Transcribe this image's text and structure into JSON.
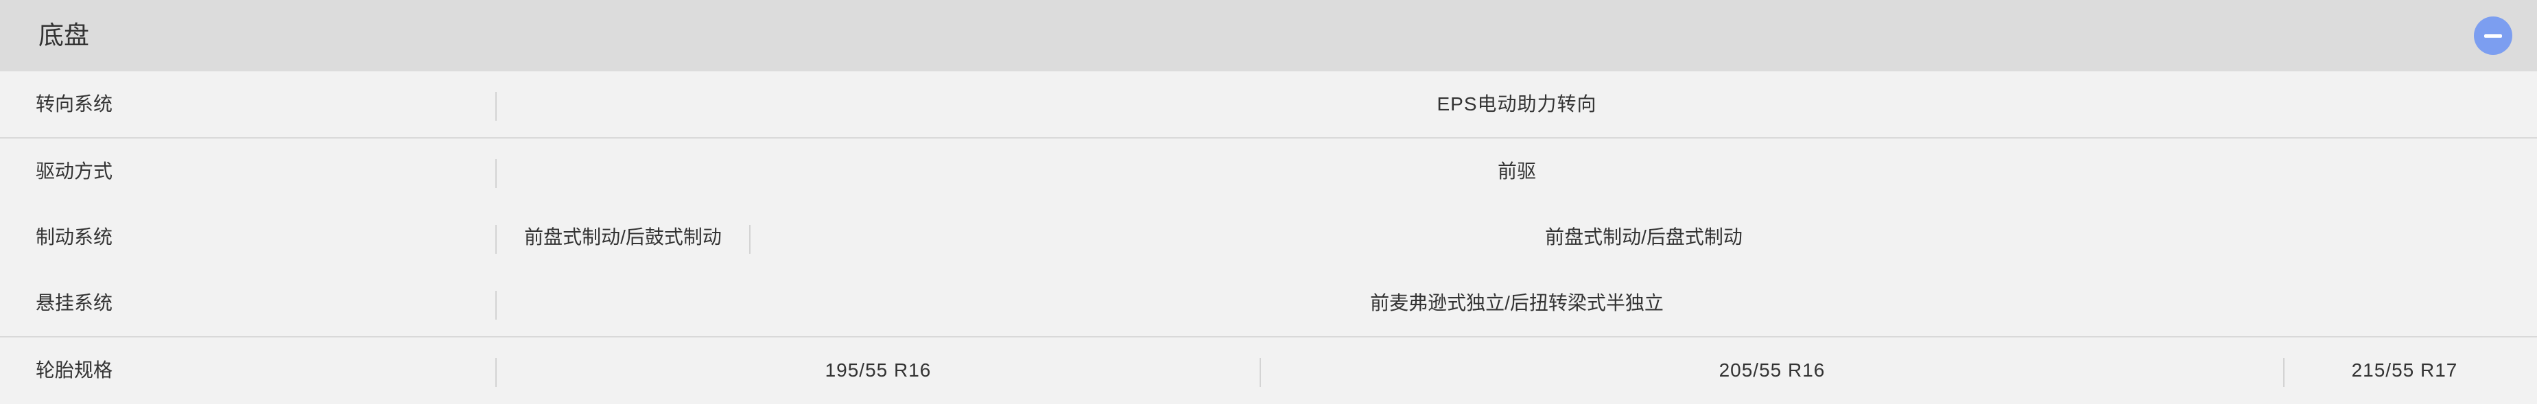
{
  "section": {
    "title": "底盘"
  },
  "rows": [
    {
      "label": "转向系统",
      "values": [
        "EPS电动助力转向"
      ]
    },
    {
      "label": "驱动方式",
      "values": [
        "前驱"
      ]
    },
    {
      "label": "制动系统",
      "values": [
        "前盘式制动/后鼓式制动",
        "前盘式制动/后盘式制动"
      ]
    },
    {
      "label": "悬挂系统",
      "values": [
        "前麦弗逊式独立/后扭转梁式半独立"
      ]
    },
    {
      "label": "轮胎规格",
      "values": [
        "195/55 R16",
        "205/55 R16",
        "215/55 R17"
      ]
    }
  ],
  "colors": {
    "header_bg": "#dcdcdc",
    "row_bg": "#f2f2f2",
    "collapse_button": "#7c9ef0"
  },
  "icons": {
    "collapse": "minus-circle-icon"
  }
}
